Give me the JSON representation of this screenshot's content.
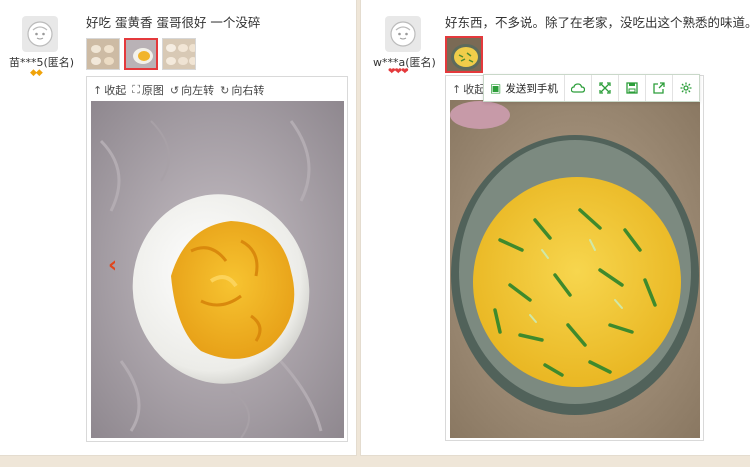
{
  "reviews": [
    {
      "username": "苗***5(匿名)",
      "badge": "◆◆",
      "text": "好吃 蛋黄香 蛋哥很好 一个没碎",
      "toolbar": {
        "collapse": "收起",
        "original": "原图",
        "rotate_left": "向左转",
        "rotate_right": "向右转"
      },
      "prev_arrow": "‹"
    },
    {
      "username": "w***a(匿名)",
      "badge": "❤❤❤",
      "text": "好东西，不多说。除了在老家，没吃出这个熟悉的味道。",
      "toolbar": {
        "collapse_partial": "收起"
      },
      "popup": {
        "send_label": "发送到手机"
      }
    }
  ],
  "colors": {
    "accent_red": "#e4393c",
    "badge_gold": "#f0a30a",
    "badge_red": "#e4393c",
    "popup_green": "#2c9e3a"
  },
  "icons": {
    "collapse": "collapse-arrow-icon",
    "original": "expand-icon",
    "rotate_left": "rotate-left-icon",
    "rotate_right": "rotate-right-icon",
    "send_phone": "phone-send-icon",
    "cloud": "cloud-icon",
    "fullscreen": "fullscreen-icon",
    "save": "save-icon",
    "share": "share-icon",
    "settings": "gear-icon"
  }
}
